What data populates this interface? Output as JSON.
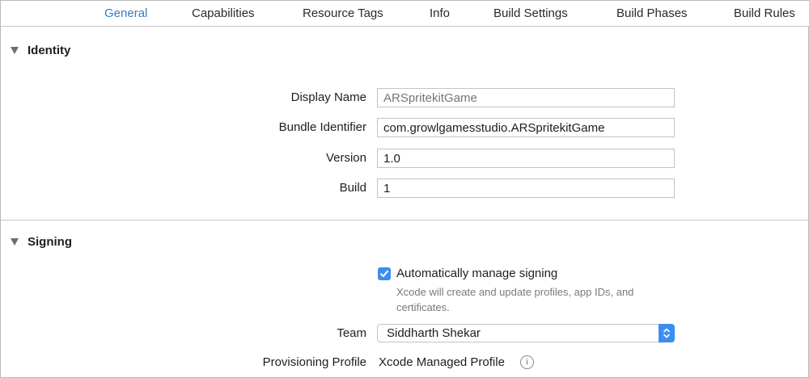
{
  "tabs": [
    {
      "label": "General",
      "active": true
    },
    {
      "label": "Capabilities",
      "active": false
    },
    {
      "label": "Resource Tags",
      "active": false
    },
    {
      "label": "Info",
      "active": false
    },
    {
      "label": "Build Settings",
      "active": false
    },
    {
      "label": "Build Phases",
      "active": false
    },
    {
      "label": "Build Rules",
      "active": false
    }
  ],
  "identity": {
    "title": "Identity",
    "display_name": {
      "label": "Display Name",
      "placeholder": "ARSpritekitGame",
      "value": ""
    },
    "bundle_identifier": {
      "label": "Bundle Identifier",
      "value": "com.growlgamesstudio.ARSpritekitGame"
    },
    "version": {
      "label": "Version",
      "value": "1.0"
    },
    "build": {
      "label": "Build",
      "value": "1"
    }
  },
  "signing": {
    "title": "Signing",
    "auto_manage": {
      "label": "Automatically manage signing",
      "checked": true
    },
    "helper": "Xcode will create and update profiles, app IDs, and certificates.",
    "team": {
      "label": "Team",
      "value": "Siddharth Shekar"
    },
    "provisioning_profile": {
      "label": "Provisioning Profile",
      "value": "Xcode Managed Profile"
    }
  },
  "icons": {
    "disclosure": "disclosure-triangle-down-icon",
    "check": "checkmark-icon",
    "stepper": "up-down-chevron-icon",
    "info": "info-circle-icon"
  },
  "colors": {
    "accent": "#3b8ef0",
    "active_tab": "#3a79c4",
    "placeholder": "#a9a9a9"
  }
}
